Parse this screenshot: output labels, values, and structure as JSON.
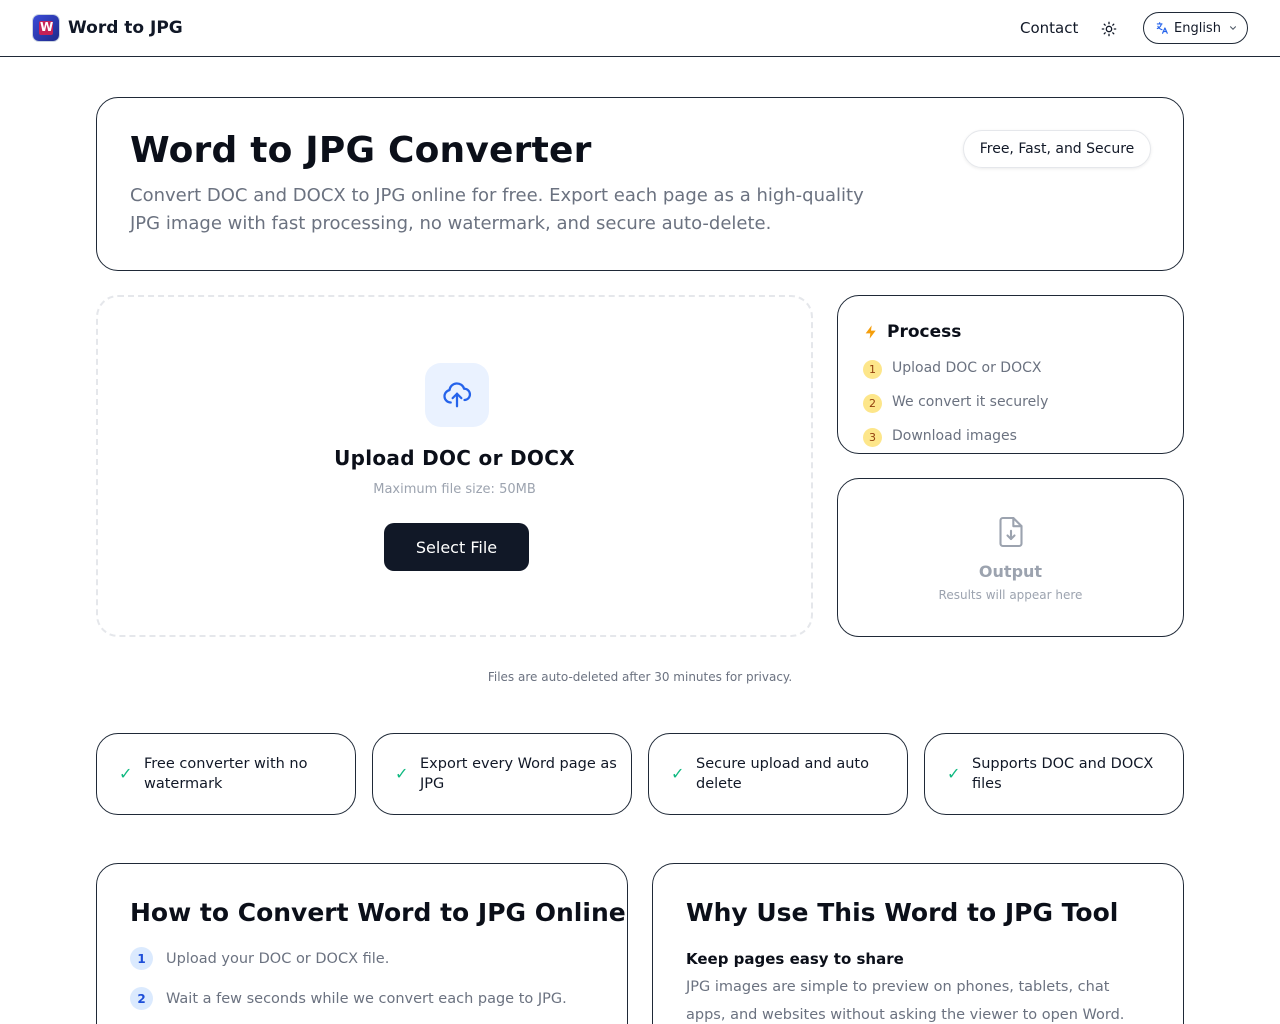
{
  "header": {
    "brand": "Word to JPG",
    "contact": "Contact",
    "language": "English",
    "icons": {
      "logo": "word-to-jpg-logo",
      "theme": "sun-icon",
      "translate": "translate-icon",
      "chevron": "chevron-down-icon"
    }
  },
  "hero": {
    "title": "Word to JPG Converter",
    "description": "Convert DOC and DOCX to JPG online for free. Export each page as a high-quality JPG image with fast processing, no watermark, and secure auto-delete.",
    "badge": "Free, Fast, and Secure"
  },
  "upload": {
    "title": "Upload DOC or DOCX",
    "max_size": "Maximum file size: 50MB",
    "button": "Select File",
    "icon": "cloud-upload-icon",
    "accent": "#2563eb"
  },
  "process": {
    "title": "Process",
    "icon": "lightning-icon",
    "steps": [
      {
        "num": "1",
        "label": "Upload DOC or DOCX"
      },
      {
        "num": "2",
        "label": "We convert it securely"
      },
      {
        "num": "3",
        "label": "Download images"
      }
    ]
  },
  "output": {
    "title": "Output",
    "subtitle": "Results will appear here",
    "icon": "file-download-icon"
  },
  "privacy_note": "Files are auto-deleted after 30 minutes for privacy.",
  "features": [
    "Free converter with no watermark",
    "Export every Word page as JPG",
    "Secure upload and auto delete",
    "Supports DOC and DOCX files"
  ],
  "howto": {
    "title": "How to Convert Word to JPG Online",
    "steps": [
      {
        "num": "1",
        "label": "Upload your DOC or DOCX file."
      },
      {
        "num": "2",
        "label": "Wait a few seconds while we convert each page to JPG."
      }
    ]
  },
  "why": {
    "title": "Why Use This Word to JPG Tool",
    "subtitle": "Keep pages easy to share",
    "body": "JPG images are simple to preview on phones, tablets, chat apps, and websites without asking the viewer to open Word."
  }
}
